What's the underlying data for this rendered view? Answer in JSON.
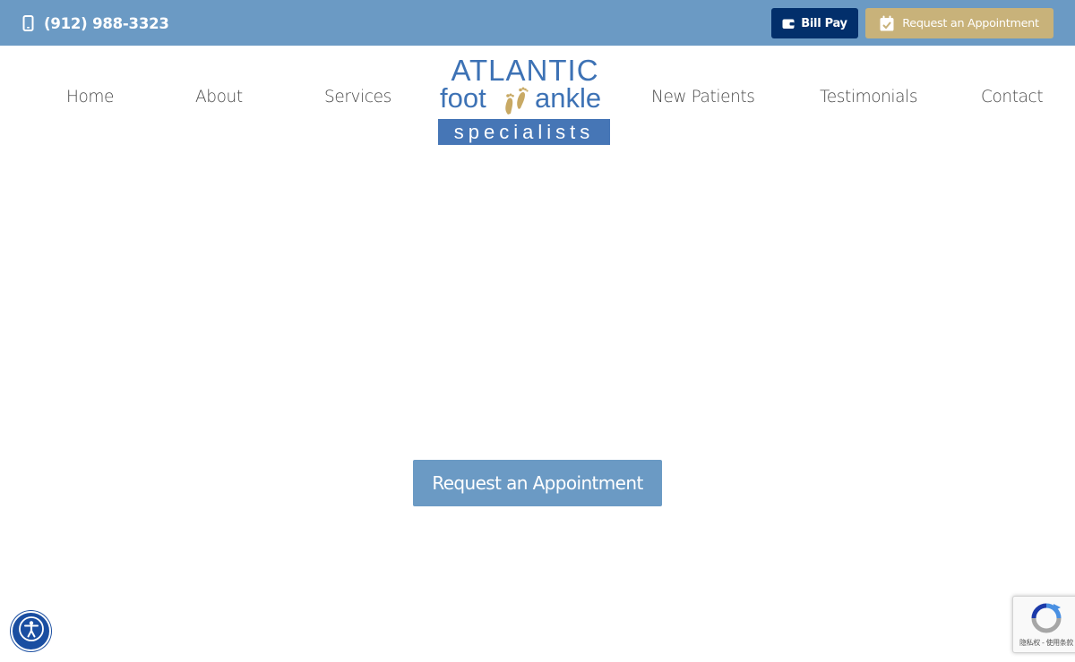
{
  "topbar": {
    "phone": "(912) 988-3323",
    "bill_pay_label": "Bill Pay",
    "request_label": "Request an Appointment"
  },
  "nav": {
    "items": [
      {
        "label": "Home"
      },
      {
        "label": "About"
      },
      {
        "label": "Services"
      },
      {
        "label": "New Patients"
      },
      {
        "label": "Testimonials"
      },
      {
        "label": "Contact"
      }
    ]
  },
  "logo": {
    "line1": "ATLANTIC",
    "word_foot": "foot",
    "word_ankle": "ankle",
    "line3": "specialists"
  },
  "main": {
    "cta_label": "Request an Appointment"
  },
  "recaptcha": {
    "links_text": "隐私权 - 使用条款"
  },
  "colors": {
    "topbar": "#6b9ac4",
    "bill_pay": "#022f6b",
    "request_gold": "#c8b27a",
    "logo_blue": "#3d72b5",
    "access_blue": "#1a4ea1"
  },
  "icons": {
    "phone": "mobile-phone-icon",
    "bill_pay": "wallet-icon",
    "request": "calendar-check-icon",
    "accessibility": "accessibility-person-icon",
    "recaptcha": "recaptcha-icon"
  }
}
